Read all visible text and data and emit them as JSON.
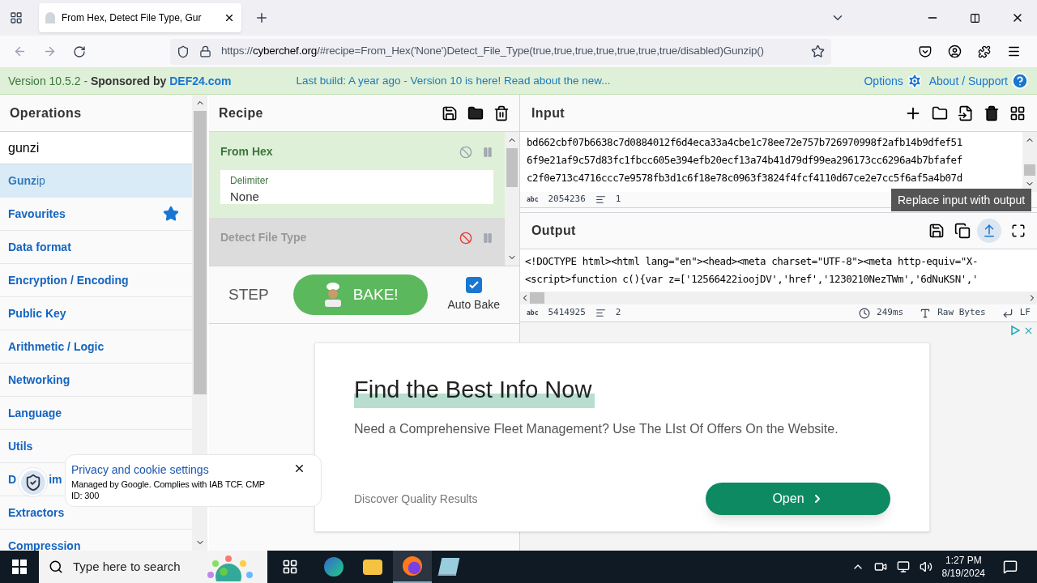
{
  "browser": {
    "tab_title": "From Hex, Detect File Type, Gur",
    "url_scheme": "https://",
    "url_host": "cyberchef.org",
    "url_rest": "/#recipe=From_Hex('None')Detect_File_Type(true,true,true,true,true,true,true/disabled)Gunzip()"
  },
  "banner": {
    "version": "Version 10.5.2 - ",
    "sponsored": "Sponsored by",
    "sponsor_link": "DEF24.com",
    "message": "Last build: A year ago - Version 10 is here! Read about the new...",
    "options": "Options",
    "about": "About / Support"
  },
  "operations": {
    "title": "Operations",
    "search": "gunzi",
    "items": [
      {
        "label": "**Gunz**ip",
        "selected": true,
        "kind": "result"
      },
      {
        "label": "Favourites",
        "selected": false,
        "kind": "favourites"
      },
      {
        "label": "Data format",
        "selected": false,
        "kind": "category"
      },
      {
        "label": "Encryption / Encoding",
        "selected": false,
        "kind": "category"
      },
      {
        "label": "Public Key",
        "selected": false,
        "kind": "category"
      },
      {
        "label": "Arithmetic / Logic",
        "selected": false,
        "kind": "category"
      },
      {
        "label": "Networking",
        "selected": false,
        "kind": "category"
      },
      {
        "label": "Language",
        "selected": false,
        "kind": "category"
      },
      {
        "label": "Utils",
        "selected": false,
        "kind": "category"
      },
      {
        "label": "D",
        "tail": "im",
        "selected": false,
        "kind": "covered"
      },
      {
        "label": "Extractors",
        "selected": false,
        "kind": "category"
      },
      {
        "label": "Compression",
        "selected": false,
        "kind": "category"
      }
    ]
  },
  "recipe": {
    "title": "Recipe",
    "steps": [
      {
        "name": "From Hex",
        "disabled": false,
        "args": [
          {
            "label": "Delimiter",
            "value": "None"
          }
        ]
      },
      {
        "name": "Detect File Type",
        "disabled": true
      }
    ],
    "step_label": "STEP",
    "bake_label": "BAKE!",
    "auto_bake": {
      "label": "Auto Bake",
      "checked": true
    }
  },
  "input": {
    "title": "Input",
    "lines": [
      "bd662cbf07b6638c7d0884012f6d4eca33a4cbe1c78ee72e757b726970998f2afb14b9dfef51",
      "6f9e21af9c57d83fc1fbcc605e394efb20ecf13a74b41d79df99ea296173cc6296a4b7bfafef",
      "c2f0e713c4716ccc7e9578fb3d1c6f18e78c0963f3824f4fcf4110d67ce2e7cc5f6af5a4b07d"
    ],
    "length_marker": "abc",
    "length": "2054236",
    "line_count": "1"
  },
  "tooltip": "Replace input with output",
  "output": {
    "title": "Output",
    "lines": [
      "<!DOCTYPE html><html lang=\"en\"><head><meta charset=\"UTF-8\"><meta http-equiv=\"X-",
      "<script>function c(){var z=['12566422ioojDV','href','1230210NezTWm','6dNuKSN','"
    ],
    "length_marker": "abc",
    "length": "5414925",
    "line_count": "2",
    "time": "249ms",
    "encoding": "Raw Bytes",
    "eol": "LF"
  },
  "ad": {
    "headline": "Find the Best Info Now",
    "body": "Need a Comprehensive Fleet Management? Use The LIst Of Offers On the Website.",
    "footer": "Discover Quality Results",
    "button": "Open"
  },
  "cookie_popup": {
    "title": "Privacy and cookie settings",
    "text": "Managed by Google. Complies with IAB TCF. CMP ID: 300"
  },
  "taskbar": {
    "search_placeholder": "Type here to search",
    "time": "1:27 PM",
    "date": "8/19/2024"
  }
}
